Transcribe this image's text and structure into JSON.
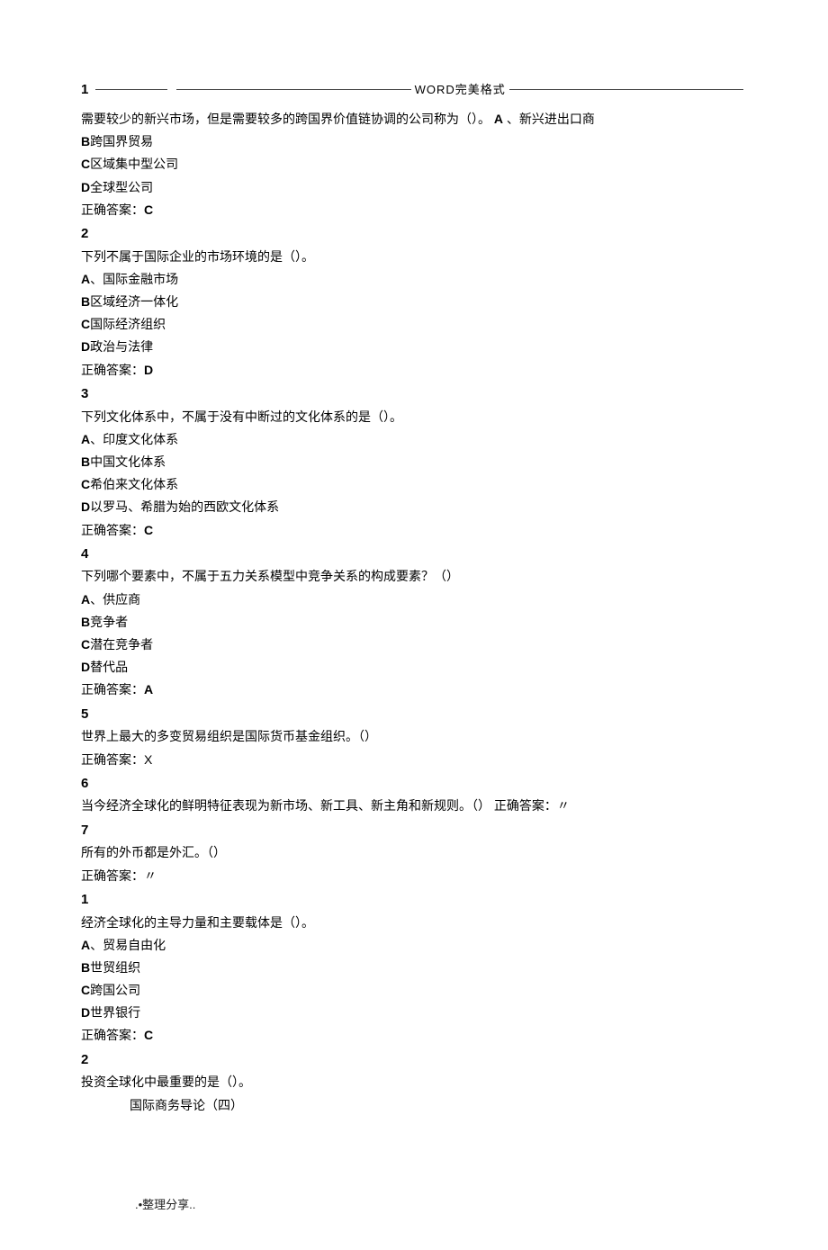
{
  "header": {
    "title": "WORD完美格式"
  },
  "questions": [
    {
      "number": "1",
      "stem_parts": [
        "需要较少的新兴市场，但是需要较多的跨国界价值链协调的公司称为（）。 ",
        "A",
        "、新兴进出口商"
      ],
      "options": [
        {
          "key": "B",
          "text": "跨国界贸易"
        },
        {
          "key": "C",
          "text": "区域集中型公司"
        },
        {
          "key": "D",
          "text": "全球型公司"
        }
      ],
      "answer_label": "正确答案：",
      "answer": "C"
    },
    {
      "number": "2",
      "stem": "下列不属于国际企业的市场环境的是（）。",
      "options": [
        {
          "key": "A",
          "text": "、国际金融市场"
        },
        {
          "key": "B",
          "text": "区域经济一体化"
        },
        {
          "key": "C",
          "text": "国际经济组织"
        },
        {
          "key": "D",
          "text": "政治与法律"
        }
      ],
      "answer_label": "正确答案：",
      "answer": "D"
    },
    {
      "number": "3",
      "stem": "下列文化体系中，不属于没有中断过的文化体系的是（）。",
      "options": [
        {
          "key": "A",
          "text": "、印度文化体系"
        },
        {
          "key": "B",
          "text": "中国文化体系"
        },
        {
          "key": "C",
          "text": "希伯来文化体系"
        },
        {
          "key": "D",
          "text": "以罗马、希腊为始的西欧文化体系"
        }
      ],
      "answer_label": "正确答案：",
      "answer": "C"
    },
    {
      "number": "4",
      "stem": "下列哪个要素中，不属于五力关系模型中竞争关系的构成要素？（）",
      "options": [
        {
          "key": "A",
          "text": "、供应商"
        },
        {
          "key": "B",
          "text": "竞争者"
        },
        {
          "key": "C",
          "text": "潜在竞争者"
        },
        {
          "key": "D",
          "text": "替代品"
        }
      ],
      "answer_label": "正确答案：",
      "answer": "A"
    },
    {
      "number": "5",
      "stem": "世界上最大的多变贸易组织是国际货币基金组织。（）",
      "answer_label": "正确答案：",
      "answer": "X"
    },
    {
      "number": "6",
      "stem_inline": "当今经济全球化的鲜明特征表现为新市场、新工具、新主角和新规则。（）  正确答案：〃"
    },
    {
      "number": "7",
      "stem": "所有的外币都是外汇。（）",
      "answer_label": "正确答案：",
      "answer": "〃"
    },
    {
      "number": "1",
      "stem": "经济全球化的主导力量和主要载体是（）。",
      "options": [
        {
          "key": "A",
          "text": "、贸易自由化"
        },
        {
          "key": "B",
          "text": "世贸组织"
        },
        {
          "key": "C",
          "text": "跨国公司"
        },
        {
          "key": "D",
          "text": "世界银行"
        }
      ],
      "answer_label": "正确答案：",
      "answer": "C"
    },
    {
      "number": "2",
      "stem": "投资全球化中最重要的是（）。",
      "subtitle": "国际商务导论（四）"
    }
  ],
  "footer": ".•整理分享.."
}
